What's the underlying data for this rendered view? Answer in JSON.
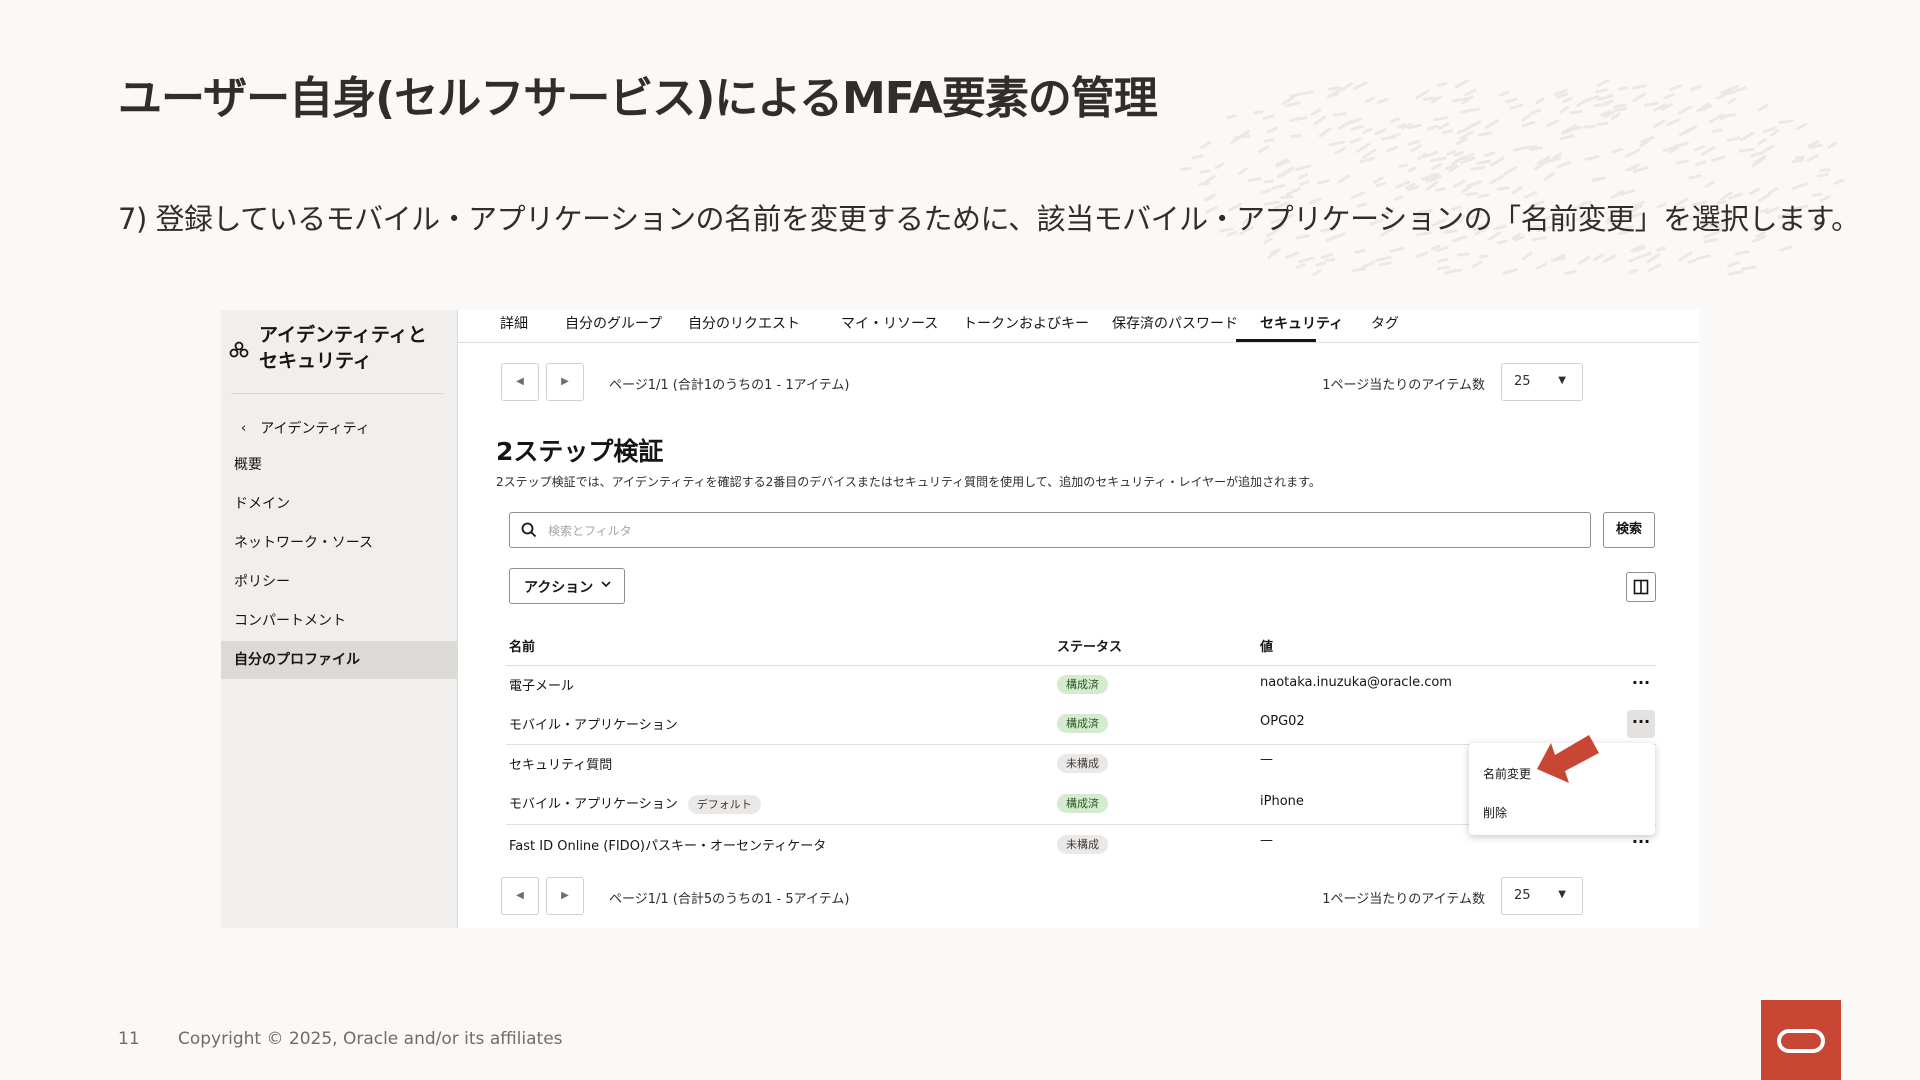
{
  "slide": {
    "title": "ユーザー自身(セルフサービス)によるMFA要素の管理",
    "instruction": "7) 登録しているモバイル・アプリケーションの名前を変更するために、該当モバイル・アプリケーションの「名前変更」を選択します。",
    "page_number": "11",
    "copyright": "Copyright © 2025, Oracle and/or its affiliates"
  },
  "sidebar": {
    "title": "アイデンティティと\nセキュリティ",
    "back_label": "アイデンティティ",
    "items": [
      {
        "label": "概要"
      },
      {
        "label": "ドメイン"
      },
      {
        "label": "ネットワーク・ソース"
      },
      {
        "label": "ポリシー"
      },
      {
        "label": "コンパートメント"
      },
      {
        "label": "自分のプロファイル",
        "active": true
      }
    ]
  },
  "tabs": [
    "詳細",
    "自分のグループ",
    "自分のリクエスト",
    "マイ・リソース",
    "トークンおよびキー",
    "保存済のパスワード",
    "セキュリティ",
    "タグ"
  ],
  "active_tab": "セキュリティ",
  "top_pager": {
    "text": "ページ1/1 (合計1のうちの1 - 1アイテム)",
    "per_page_label": "1ページ当たりのアイテム数",
    "per_page_value": "25"
  },
  "section": {
    "title": "2ステップ検証",
    "description": "2ステップ検証では、アイデンティティを確認する2番目のデバイスまたはセキュリティ質問を使用して、追加のセキュリティ・レイヤーが追加されます。"
  },
  "search": {
    "placeholder": "検索とフィルタ",
    "button": "検索"
  },
  "actions_button": "アクション",
  "table": {
    "columns": [
      "名前",
      "ステータス",
      "値"
    ],
    "rows": [
      {
        "name": "電子メール",
        "status": "構成済",
        "status_type": "configured",
        "value": "naotaka.inuzuka@oracle.com"
      },
      {
        "name": "モバイル・アプリケーション",
        "status": "構成済",
        "status_type": "configured",
        "value": "OPG02"
      },
      {
        "name": "セキュリティ質問",
        "status": "未構成",
        "status_type": "not-configured",
        "value": "—"
      },
      {
        "name": "モバイル・アプリケーション",
        "badge": "デフォルト",
        "status": "構成済",
        "status_type": "configured",
        "value": "iPhone"
      },
      {
        "name": "Fast ID Online (FIDO)パスキー・オーセンティケータ",
        "status": "未構成",
        "status_type": "not-configured",
        "value": "—"
      }
    ]
  },
  "row_menu": {
    "items": [
      "名前変更",
      "削除"
    ]
  },
  "bottom_pager": {
    "text": "ページ1/1 (合計5のうちの1 - 5アイテム)",
    "per_page_label": "1ページ当たりのアイテム数",
    "per_page_value": "25"
  },
  "colors": {
    "oracle_red": "#c74634",
    "configured_badge": "#d4ebd0",
    "not_configured_badge": "#ebe9e7",
    "sidebar_bg": "#f1efed"
  }
}
